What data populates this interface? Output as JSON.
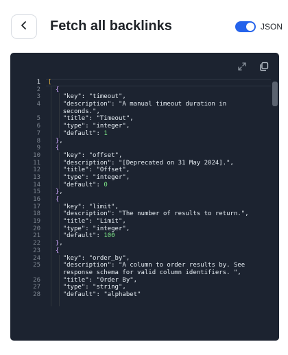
{
  "header": {
    "title": "Fetch all backlinks",
    "back_icon": "chevron-left-icon",
    "toggle_label": "JSON",
    "toggle_on": true,
    "accent_color": "#2563eb"
  },
  "editor": {
    "toolbar_icons": [
      "expand-icon",
      "copy-icon"
    ],
    "lines": [
      {
        "n": "1",
        "parts": [
          [
            "b1",
            "["
          ]
        ],
        "active": true
      },
      {
        "n": "2",
        "parts": [
          [
            "p",
            "  "
          ],
          [
            "b2",
            "{"
          ]
        ]
      },
      {
        "n": "3",
        "parts": [
          [
            "p",
            "    "
          ],
          [
            "k",
            "\"key\""
          ],
          [
            "p",
            ": "
          ],
          [
            "s",
            "\"timeout\""
          ],
          [
            "p",
            ","
          ]
        ]
      },
      {
        "n": "4",
        "parts": [
          [
            "p",
            "    "
          ],
          [
            "k",
            "\"description\""
          ],
          [
            "p",
            ": "
          ],
          [
            "s",
            "\"A manual timeout duration in"
          ]
        ]
      },
      {
        "n": "",
        "parts": [
          [
            "p",
            "    "
          ],
          [
            "s",
            "seconds.\""
          ],
          [
            "p",
            ","
          ]
        ]
      },
      {
        "n": "5",
        "parts": [
          [
            "p",
            "    "
          ],
          [
            "k",
            "\"title\""
          ],
          [
            "p",
            ": "
          ],
          [
            "s",
            "\"Timeout\""
          ],
          [
            "p",
            ","
          ]
        ]
      },
      {
        "n": "6",
        "parts": [
          [
            "p",
            "    "
          ],
          [
            "k",
            "\"type\""
          ],
          [
            "p",
            ": "
          ],
          [
            "s",
            "\"integer\""
          ],
          [
            "p",
            ","
          ]
        ]
      },
      {
        "n": "7",
        "parts": [
          [
            "p",
            "    "
          ],
          [
            "k",
            "\"default\""
          ],
          [
            "p",
            ": "
          ],
          [
            "n",
            "1"
          ]
        ]
      },
      {
        "n": "8",
        "parts": [
          [
            "p",
            "  "
          ],
          [
            "b2",
            "}"
          ],
          [
            "p",
            ","
          ]
        ]
      },
      {
        "n": "9",
        "parts": [
          [
            "p",
            "  "
          ],
          [
            "b2",
            "{"
          ]
        ]
      },
      {
        "n": "10",
        "parts": [
          [
            "p",
            "    "
          ],
          [
            "k",
            "\"key\""
          ],
          [
            "p",
            ": "
          ],
          [
            "s",
            "\"offset\""
          ],
          [
            "p",
            ","
          ]
        ]
      },
      {
        "n": "11",
        "parts": [
          [
            "p",
            "    "
          ],
          [
            "k",
            "\"description\""
          ],
          [
            "p",
            ": "
          ],
          [
            "s",
            "\"[Deprecated on 31 May 2024].\""
          ],
          [
            "p",
            ","
          ]
        ]
      },
      {
        "n": "12",
        "parts": [
          [
            "p",
            "    "
          ],
          [
            "k",
            "\"title\""
          ],
          [
            "p",
            ": "
          ],
          [
            "s",
            "\"Offset\""
          ],
          [
            "p",
            ","
          ]
        ]
      },
      {
        "n": "13",
        "parts": [
          [
            "p",
            "    "
          ],
          [
            "k",
            "\"type\""
          ],
          [
            "p",
            ": "
          ],
          [
            "s",
            "\"integer\""
          ],
          [
            "p",
            ","
          ]
        ]
      },
      {
        "n": "14",
        "parts": [
          [
            "p",
            "    "
          ],
          [
            "k",
            "\"default\""
          ],
          [
            "p",
            ": "
          ],
          [
            "n",
            "0"
          ]
        ]
      },
      {
        "n": "15",
        "parts": [
          [
            "p",
            "  "
          ],
          [
            "b2",
            "}"
          ],
          [
            "p",
            ","
          ]
        ]
      },
      {
        "n": "16",
        "parts": [
          [
            "p",
            "  "
          ],
          [
            "b2",
            "{"
          ]
        ]
      },
      {
        "n": "17",
        "parts": [
          [
            "p",
            "    "
          ],
          [
            "k",
            "\"key\""
          ],
          [
            "p",
            ": "
          ],
          [
            "s",
            "\"limit\""
          ],
          [
            "p",
            ","
          ]
        ]
      },
      {
        "n": "18",
        "parts": [
          [
            "p",
            "    "
          ],
          [
            "k",
            "\"description\""
          ],
          [
            "p",
            ": "
          ],
          [
            "s",
            "\"The number of results to return.\""
          ],
          [
            "p",
            ","
          ]
        ]
      },
      {
        "n": "19",
        "parts": [
          [
            "p",
            "    "
          ],
          [
            "k",
            "\"title\""
          ],
          [
            "p",
            ": "
          ],
          [
            "s",
            "\"Limit\""
          ],
          [
            "p",
            ","
          ]
        ]
      },
      {
        "n": "20",
        "parts": [
          [
            "p",
            "    "
          ],
          [
            "k",
            "\"type\""
          ],
          [
            "p",
            ": "
          ],
          [
            "s",
            "\"integer\""
          ],
          [
            "p",
            ","
          ]
        ]
      },
      {
        "n": "21",
        "parts": [
          [
            "p",
            "    "
          ],
          [
            "k",
            "\"default\""
          ],
          [
            "p",
            ": "
          ],
          [
            "n",
            "100"
          ]
        ]
      },
      {
        "n": "22",
        "parts": [
          [
            "p",
            "  "
          ],
          [
            "b2",
            "}"
          ],
          [
            "p",
            ","
          ]
        ]
      },
      {
        "n": "23",
        "parts": [
          [
            "p",
            "  "
          ],
          [
            "b2",
            "{"
          ]
        ]
      },
      {
        "n": "24",
        "parts": [
          [
            "p",
            "    "
          ],
          [
            "k",
            "\"key\""
          ],
          [
            "p",
            ": "
          ],
          [
            "s",
            "\"order_by\""
          ],
          [
            "p",
            ","
          ]
        ]
      },
      {
        "n": "25",
        "parts": [
          [
            "p",
            "    "
          ],
          [
            "k",
            "\"description\""
          ],
          [
            "p",
            ": "
          ],
          [
            "s",
            "\"A column to order results by. See"
          ]
        ]
      },
      {
        "n": "",
        "parts": [
          [
            "p",
            "    "
          ],
          [
            "s",
            "response schema for valid column identifiers. \""
          ],
          [
            "p",
            ","
          ]
        ]
      },
      {
        "n": "26",
        "parts": [
          [
            "p",
            "    "
          ],
          [
            "k",
            "\"title\""
          ],
          [
            "p",
            ": "
          ],
          [
            "s",
            "\"Order By\""
          ],
          [
            "p",
            ","
          ]
        ]
      },
      {
        "n": "27",
        "parts": [
          [
            "p",
            "    "
          ],
          [
            "k",
            "\"type\""
          ],
          [
            "p",
            ": "
          ],
          [
            "s",
            "\"string\""
          ],
          [
            "p",
            ","
          ]
        ]
      },
      {
        "n": "28",
        "parts": [
          [
            "p",
            "    "
          ],
          [
            "k",
            "\"default\""
          ],
          [
            "p",
            ": "
          ],
          [
            "s",
            "\"alphabet\""
          ]
        ]
      }
    ]
  }
}
